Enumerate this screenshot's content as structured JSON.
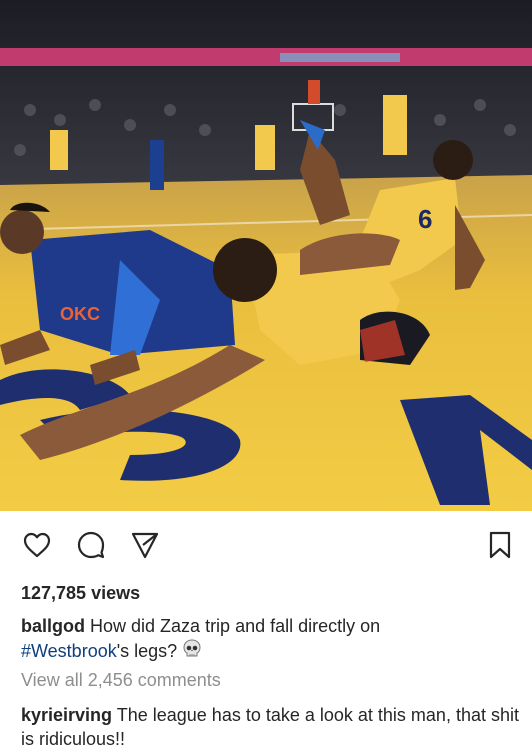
{
  "post": {
    "views": "127,785 views",
    "caption": {
      "username": "ballgod",
      "text_before_hashtag": "How did Zaza trip and fall directly on",
      "hashtag": "#Westbrook",
      "text_after_hashtag": "'s legs?",
      "emoji_icon": "skull-icon"
    },
    "view_all_comments": "View all 2,456 comments",
    "top_comment": {
      "username": "kyrieirving",
      "text": "The league has to take a look at this man, that shit is ridiculous!!"
    }
  },
  "media": {
    "jersey_number_front": "6"
  },
  "icons": {
    "like": "heart-icon",
    "comment": "comment-bubble-icon",
    "share": "paper-plane-icon",
    "save": "bookmark-icon"
  },
  "colors": {
    "text": "#262626",
    "muted": "#8e8e8e",
    "hashtag": "#0f3e7e",
    "court_yellow": "#f2c94c",
    "paint_navy": "#1e2e6e"
  }
}
